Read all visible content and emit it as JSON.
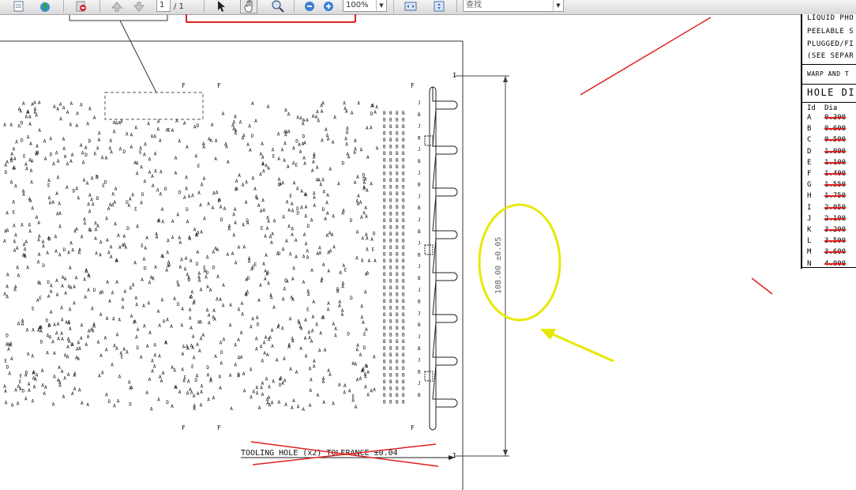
{
  "toolbar": {
    "page_current": "1",
    "page_total": "/ 1",
    "zoom": "100%",
    "search_placeholder": "查找"
  },
  "drawing": {
    "tooling_note": "TOOLING HOLE (x2) TOLERANCE ±0.04",
    "dimension": "108.00 ±0.05",
    "dim_marker_top": "I",
    "dim_marker_bottom": "I",
    "f_labels": [
      "F",
      "F",
      "F",
      "F",
      "F",
      "F"
    ]
  },
  "notes_table": {
    "line1": "LIQUID PHO",
    "line2": "PEELABLE S",
    "line3": "PLUGGED/FI",
    "line4": "(SEE SEPAR",
    "line5": "WARP AND T",
    "hole_title": "HOLE DI",
    "header_id": "Id",
    "header_dia": "Dia",
    "rows": [
      {
        "id": "A",
        "dia": "0.300"
      },
      {
        "id": "B",
        "dia": "0.600"
      },
      {
        "id": "C",
        "dia": "0.500"
      },
      {
        "id": "D",
        "dia": "1.000"
      },
      {
        "id": "E",
        "dia": "1.100"
      },
      {
        "id": "F",
        "dia": "1.400"
      },
      {
        "id": "G",
        "dia": "1.550"
      },
      {
        "id": "H",
        "dia": "1.750"
      },
      {
        "id": "I",
        "dia": "2.050"
      },
      {
        "id": "J",
        "dia": "2.100"
      },
      {
        "id": "K",
        "dia": "3.200"
      },
      {
        "id": "L",
        "dia": "3.500"
      },
      {
        "id": "M",
        "dia": "3.600"
      },
      {
        "id": "N",
        "dia": "4.000"
      }
    ]
  },
  "colors": {
    "markup_red": "#e02020",
    "highlight_yellow": "#e8e800",
    "drawing_black": "#111111"
  }
}
